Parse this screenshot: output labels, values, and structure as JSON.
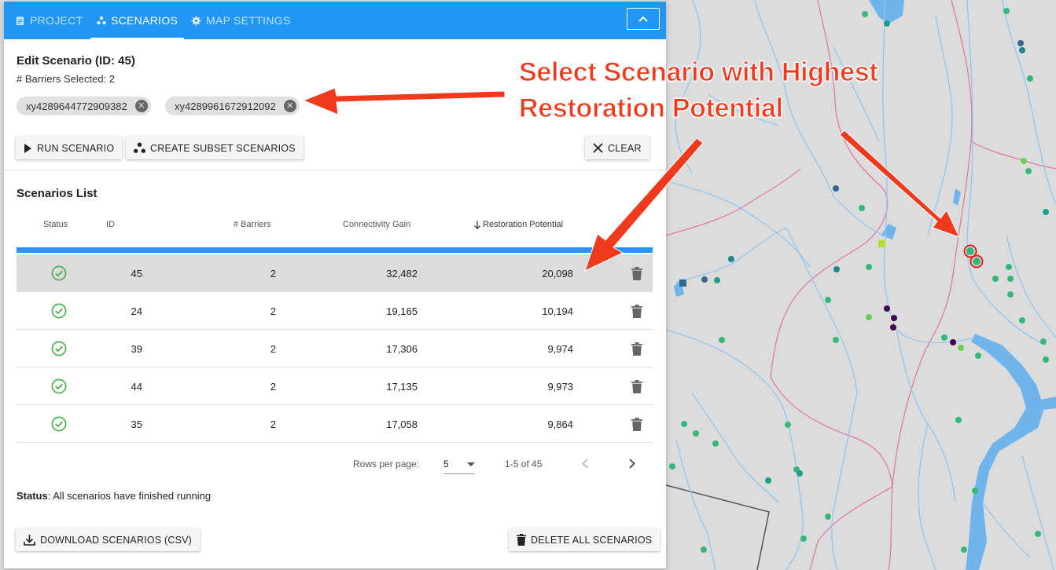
{
  "tabs": [
    {
      "label": "PROJECT",
      "icon": "clipboard-icon"
    },
    {
      "label": "SCENARIOS",
      "icon": "scatter-dots-icon"
    },
    {
      "label": "MAP SETTINGS",
      "icon": "gear-icon"
    }
  ],
  "edit": {
    "title": "Edit Scenario (ID: 45)",
    "barriers_selected": "# Barriers Selected: 2",
    "chips": [
      "xy4289644772909382",
      "xy4289961672912092"
    ],
    "run_label": "RUN SCENARIO",
    "subset_label": "CREATE SUBSET SCENARIOS",
    "clear_label": "CLEAR"
  },
  "list": {
    "title": "Scenarios List",
    "columns": {
      "status": "Status",
      "id": "ID",
      "barriers": "# Barriers",
      "gain": "Connectivity Gain",
      "potential": "Restoration Potential"
    },
    "rows": [
      {
        "id": "45",
        "barriers": "2",
        "gain": "32,482",
        "potential": "20,098",
        "selected": true
      },
      {
        "id": "24",
        "barriers": "2",
        "gain": "19,165",
        "potential": "10,194",
        "selected": false
      },
      {
        "id": "39",
        "barriers": "2",
        "gain": "17,306",
        "potential": "9,974",
        "selected": false
      },
      {
        "id": "44",
        "barriers": "2",
        "gain": "17,135",
        "potential": "9,973",
        "selected": false
      },
      {
        "id": "35",
        "barriers": "2",
        "gain": "17,058",
        "potential": "9,864",
        "selected": false
      }
    ],
    "pagination": {
      "rows_per_page_label": "Rows per page:",
      "rows_per_page": "5",
      "range": "1-5 of 45"
    }
  },
  "status": {
    "label": "Status",
    "text": ": All scenarios have finished running"
  },
  "footer": {
    "download_label": "DOWNLOAD SCENARIOS (CSV)",
    "delete_all_label": "DELETE ALL SCENARIOS"
  },
  "annotation": {
    "line1": "Select Scenario with Highest",
    "line2": "Restoration Potential"
  },
  "colors": {
    "tab_bar": "#2196f3",
    "success": "#4caf50",
    "annotation": "#f03a1e",
    "river": "#8ec5ef",
    "boundary": "#e07aa6"
  }
}
